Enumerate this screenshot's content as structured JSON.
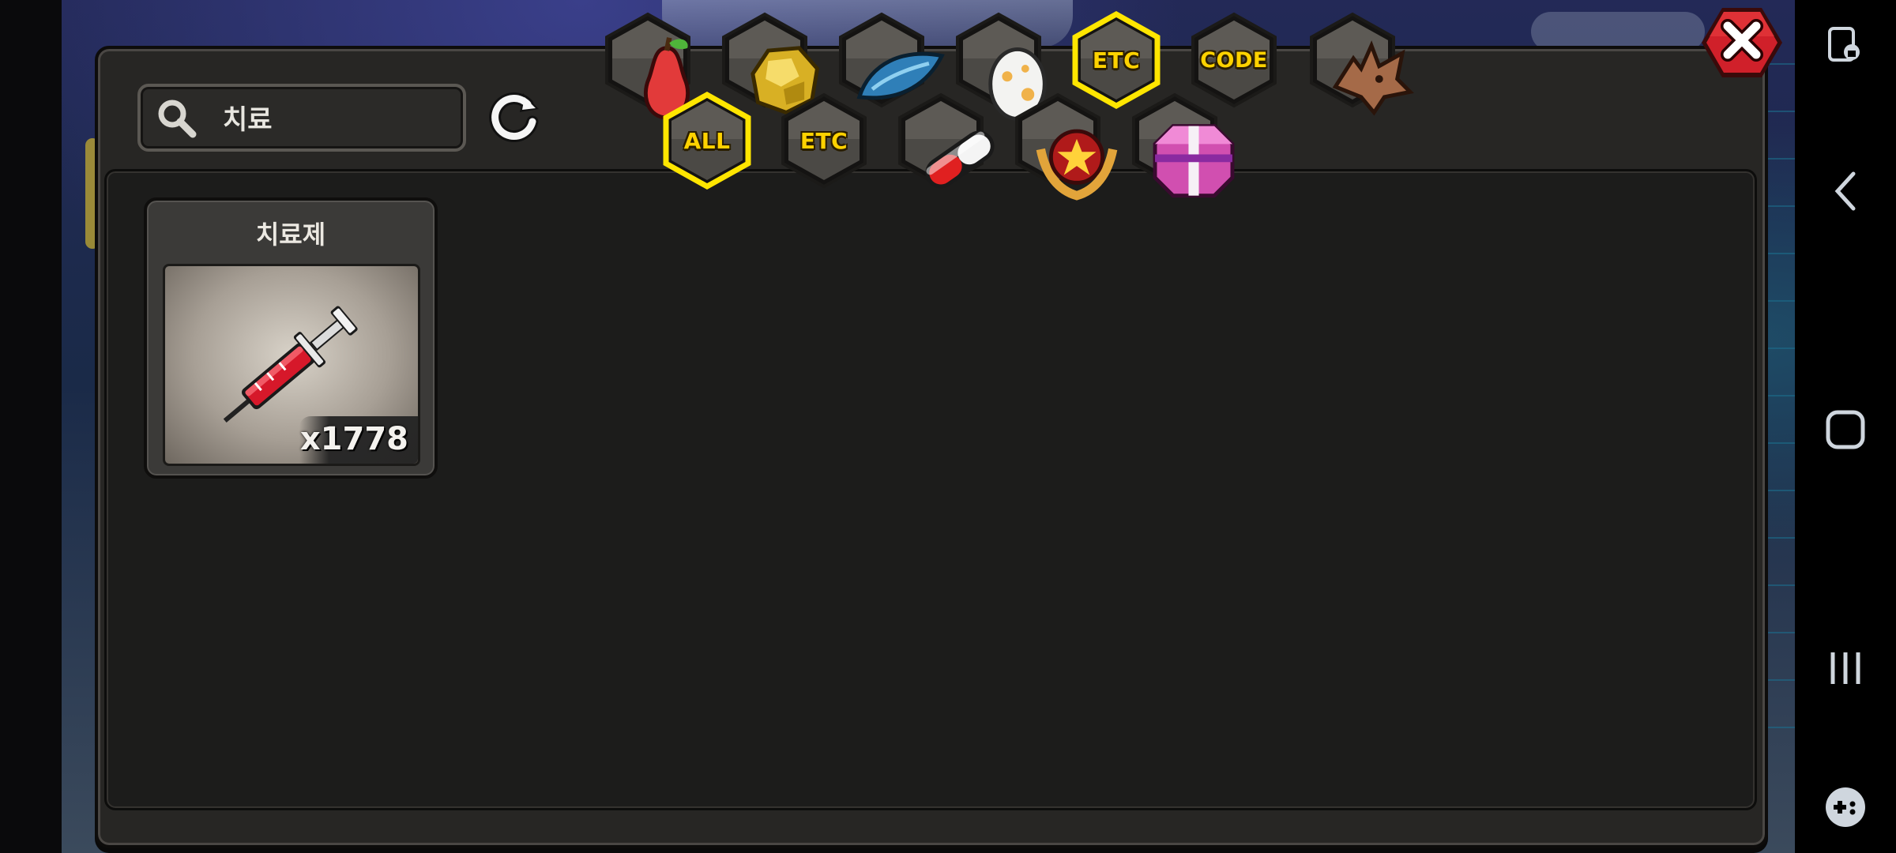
{
  "search": {
    "value": "치료"
  },
  "tabs_row1": [
    {
      "name": "tab-fruit",
      "label": "",
      "icon": "pear-icon",
      "selected": false
    },
    {
      "name": "tab-ore",
      "label": "",
      "icon": "gold-ore-icon",
      "selected": false
    },
    {
      "name": "tab-scale",
      "label": "",
      "icon": "blue-scale-icon",
      "selected": false
    },
    {
      "name": "tab-egg",
      "label": "",
      "icon": "egg-icon",
      "selected": false
    },
    {
      "name": "tab-etc",
      "label": "ETC",
      "icon": "",
      "selected": true
    },
    {
      "name": "tab-code",
      "label": "CODE",
      "icon": "",
      "selected": false
    },
    {
      "name": "tab-dragon",
      "label": "",
      "icon": "dragon-head-icon",
      "selected": false
    }
  ],
  "tabs_row2": [
    {
      "name": "subtab-all",
      "label": "ALL",
      "icon": "",
      "selected": true
    },
    {
      "name": "subtab-etc",
      "label": "ETC",
      "icon": "",
      "selected": false
    },
    {
      "name": "subtab-capsule",
      "label": "",
      "icon": "capsule-icon",
      "selected": false
    },
    {
      "name": "subtab-medal",
      "label": "",
      "icon": "star-medal-icon",
      "selected": false
    },
    {
      "name": "subtab-gift",
      "label": "",
      "icon": "gift-box-icon",
      "selected": false
    }
  ],
  "items": [
    {
      "name": "치료제",
      "count": "x1778",
      "icon": "syringe-icon"
    }
  ],
  "colors": {
    "accent_yellow": "#ffd200",
    "close_red": "#d0202a",
    "panel": "#272624"
  }
}
